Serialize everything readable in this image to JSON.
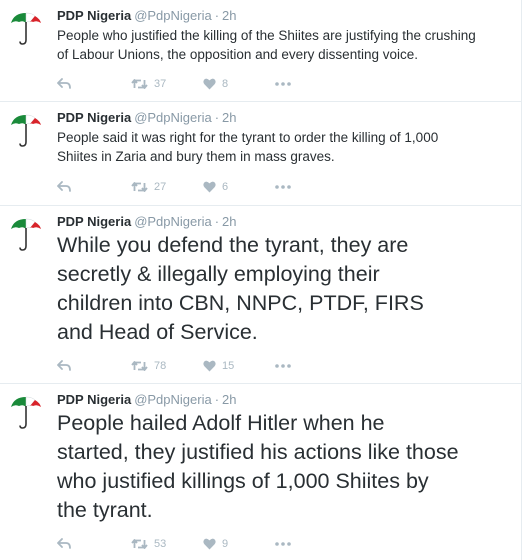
{
  "tweets": [
    {
      "name": "PDP Nigeria",
      "handle": "@PdpNigeria",
      "separator": "·",
      "time": "2h",
      "text": "People who justified the killing of the Shiites are justifying  the crushing\nof Labour Unions, the opposition and every dissenting voice.",
      "retweets": "37",
      "likes": "8"
    },
    {
      "name": "PDP Nigeria",
      "handle": "@PdpNigeria",
      "separator": "·",
      "time": "2h",
      "text": "People said it was right for the tyrant to order the killing of 1,000\nShiites in Zaria and bury them in mass graves.",
      "retweets": "27",
      "likes": "6"
    },
    {
      "name": "PDP Nigeria",
      "handle": "@PdpNigeria",
      "separator": "·",
      "time": "2h",
      "text": "While you defend the tyrant, they are\nsecretly & illegally employing their\nchildren into CBN, NNPC, PTDF, FIRS\nand Head of Service.",
      "retweets": "78",
      "likes": "15"
    },
    {
      "name": "PDP Nigeria",
      "handle": "@PdpNigeria",
      "separator": "·",
      "time": "2h",
      "text": "People hailed Adolf Hitler when he\nstarted, they justified his actions like those\nwho justified killings of 1,000 Shiites by\nthe tyrant.",
      "retweets": "53",
      "likes": "9"
    }
  ],
  "icons": {
    "avatar": "pdp-umbrella-logo-icon",
    "reply": "reply-icon",
    "retweet": "retweet-icon",
    "like": "heart-icon",
    "more": "more-dots-icon"
  },
  "colors": {
    "umbrella_green": "#1a8a3a",
    "umbrella_white": "#ffffff",
    "umbrella_red": "#d8232a",
    "handle_gray": "#8899a6",
    "action_gray": "#aab8c2",
    "text": "#292f33"
  }
}
